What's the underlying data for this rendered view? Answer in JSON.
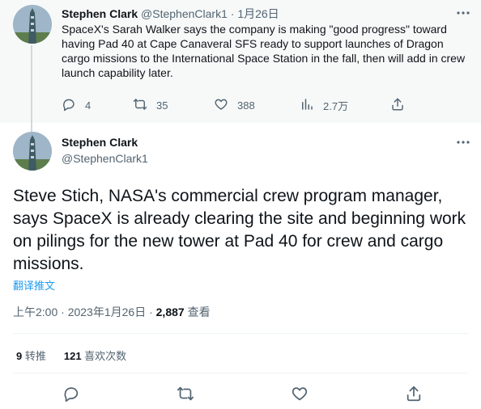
{
  "parent_tweet": {
    "author_name": "Stephen Clark",
    "author_handle": "@StephenClark1",
    "date": "1月26日",
    "text": "SpaceX's Sarah Walker says the company is making \"good progress\" toward having Pad 40 at Cape Canaveral SFS ready to support launches of Dragon cargo missions to the International Space Station in the fall, then will add in crew launch capability later.",
    "actions": {
      "replies": "4",
      "retweets": "35",
      "likes": "388",
      "views": "2.7万"
    }
  },
  "main_tweet": {
    "author_name": "Stephen Clark",
    "author_handle": "@StephenClark1",
    "text": "Steve Stich, NASA's commercial crew program manager, says SpaceX is already clearing the site and beginning work on pilings for the new tower at Pad 40 for crew and cargo missions.",
    "translate_label": "翻译推文",
    "time": "上午2:00 · 2023年1月26日 · ",
    "views_count": "2,887",
    "views_label": " 查看",
    "retweet_count": "9",
    "retweet_label": " 转推",
    "like_count": "121",
    "like_label": " 喜欢次数"
  },
  "colors": {
    "accent": "#1d9bf0",
    "text": "#0f1419",
    "secondary": "#536471",
    "parent_bg": "#f7f9f9"
  },
  "icons": [
    "more-icon",
    "reply-icon",
    "retweet-icon",
    "like-icon",
    "views-icon",
    "share-icon"
  ]
}
